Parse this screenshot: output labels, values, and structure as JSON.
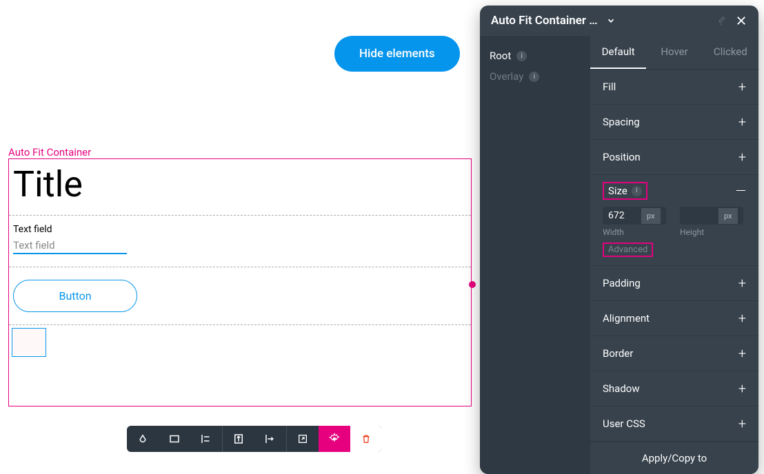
{
  "hide_button": "Hide elements",
  "canvas": {
    "label": "Auto Fit Container",
    "title": "Title",
    "textfield_label": "Text field",
    "textfield_placeholder": "Text field",
    "button_label": "Button"
  },
  "panel": {
    "title": "Auto Fit Container …",
    "tree": {
      "root": "Root",
      "root_badge": "i",
      "overlay": "Overlay",
      "overlay_badge": "i"
    },
    "tabs": {
      "default": "Default",
      "hover": "Hover",
      "clicked": "Clicked"
    },
    "sections": {
      "fill": "Fill",
      "spacing": "Spacing",
      "position": "Position",
      "size": {
        "label": "Size",
        "badge": "i",
        "width_value": "672",
        "width_unit": "px",
        "width_label": "Width",
        "height_value": "",
        "height_unit": "px",
        "height_label": "Height",
        "advanced": "Advanced"
      },
      "padding": "Padding",
      "alignment": "Alignment",
      "border": "Border",
      "shadow": "Shadow",
      "usercss": "User CSS"
    },
    "apply": "Apply/Copy to"
  }
}
